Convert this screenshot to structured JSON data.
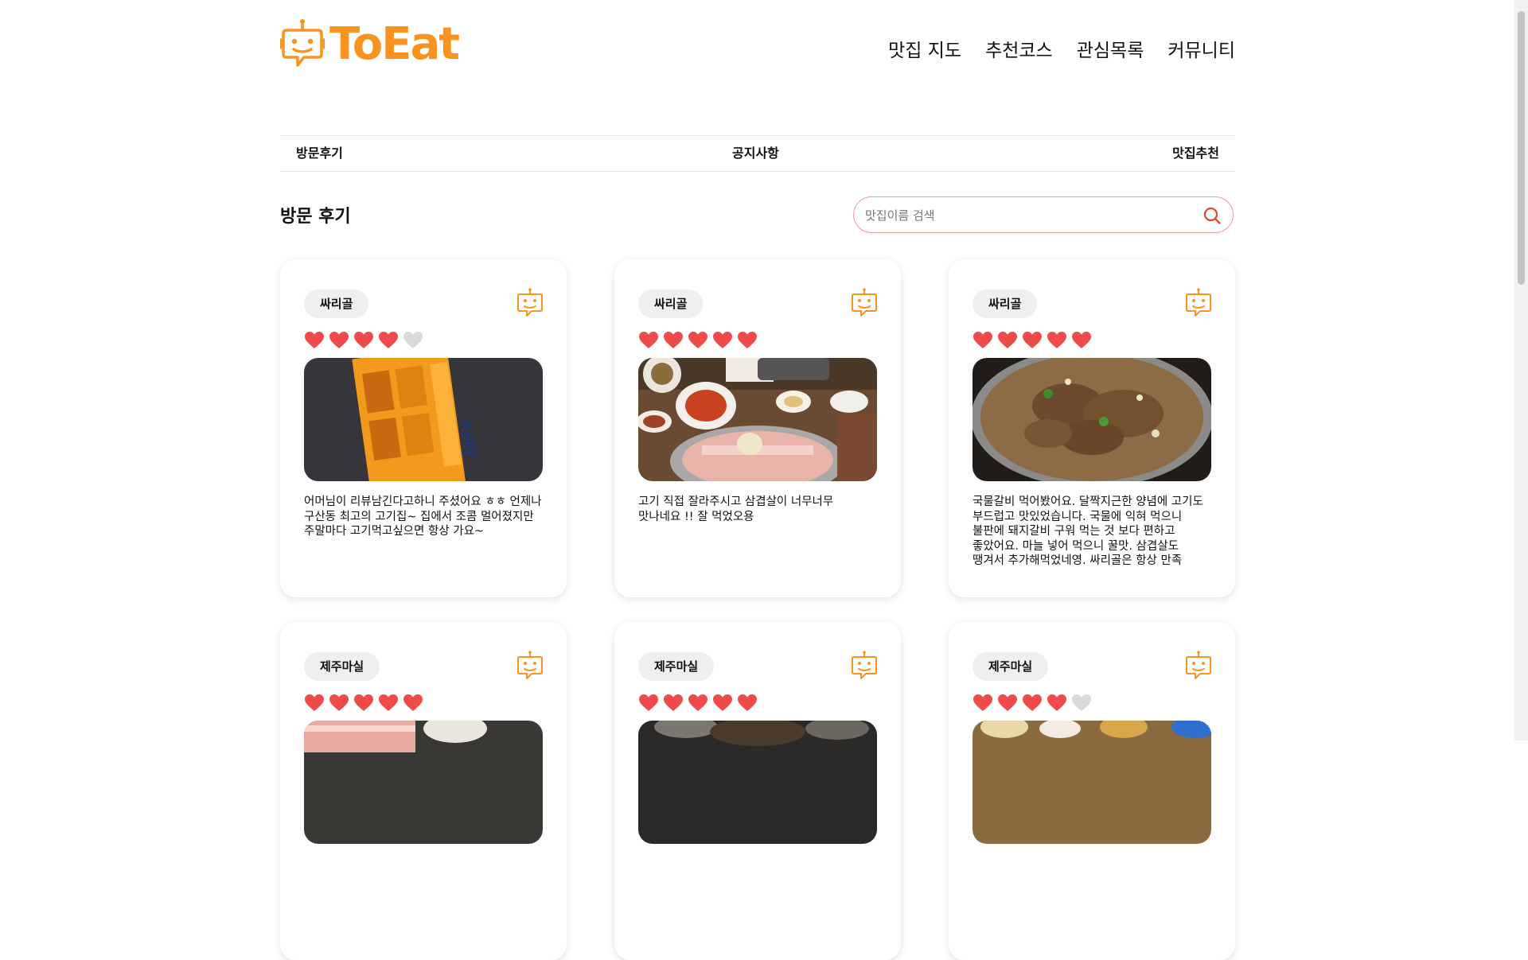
{
  "brand": {
    "name": "ToEat",
    "color": "#f7931e"
  },
  "nav": [
    "맛집 지도",
    "추천코스",
    "관심목록",
    "커뮤니티"
  ],
  "board_tabs": [
    "방문후기",
    "공지사항",
    "맛집추천"
  ],
  "section_title": "방문 후기",
  "search": {
    "placeholder": "맛집이름 검색",
    "value": ""
  },
  "colors": {
    "heart_on": "#f04b4b",
    "heart_off": "#d9d9d9",
    "search_border": "#f29b9b",
    "accent": "#f7931e"
  },
  "cards": [
    {
      "restaurant": "싸리골",
      "rating": 4,
      "photo": "beer-crate",
      "review": "어머님이 리뷰남긴다고하니 주셨어요 ㅎㅎ 언제나 구산동 최고의 고기집~ 집에서 조콤 멀어졌지만 주말마다 고기먹고싶으면 항상 가요~"
    },
    {
      "restaurant": "싸리골",
      "rating": 5,
      "photo": "pork-belly-table",
      "review": "고기 직접 잘라주시고 삼겹살이 너무너무 맛나네요 !! 잘 먹었오용"
    },
    {
      "restaurant": "싸리골",
      "rating": 5,
      "photo": "galbi-stew",
      "review": "국물갈비 먹어봤어요. 달짝지근한 양념에 고기도 부드럽고 맛있었습니다. 국물에 익혀 먹으니 불판에 돼지갈비 구워 먹는 것 보다 편하고 좋았어요. 마늘 넣어 먹으니 꿀맛. 삼겹살도 땡겨서 추가해먹었네영. 싸리골은 항상 만족"
    },
    {
      "restaurant": "제주마실",
      "rating": 5,
      "photo": "raw-pork",
      "review": ""
    },
    {
      "restaurant": "제주마실",
      "rating": 5,
      "photo": "grill",
      "review": ""
    },
    {
      "restaurant": "제주마실",
      "rating": 4,
      "photo": "side-dishes",
      "review": ""
    }
  ]
}
